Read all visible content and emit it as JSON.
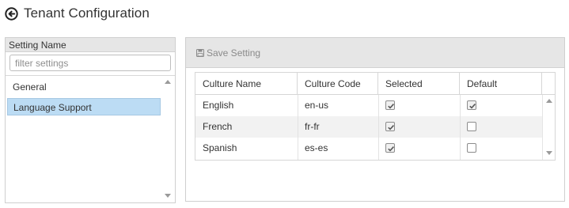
{
  "header": {
    "title": "Tenant Configuration",
    "back_icon": "circle-arrow-left-icon"
  },
  "settings_panel": {
    "header": "Setting Name",
    "filter": {
      "placeholder": "filter settings",
      "value": ""
    },
    "items": [
      {
        "label": "General",
        "selected": false
      },
      {
        "label": "Language Support",
        "selected": true
      }
    ]
  },
  "detail_panel": {
    "toolbar": {
      "save_label": "Save Setting",
      "save_icon": "floppy-disk-icon"
    },
    "grid": {
      "columns": [
        "Culture Name",
        "Culture Code",
        "Selected",
        "Default"
      ],
      "rows": [
        {
          "culture_name": "English",
          "culture_code": "en-us",
          "selected": true,
          "default": true
        },
        {
          "culture_name": "French",
          "culture_code": "fr-fr",
          "selected": true,
          "default": false
        },
        {
          "culture_name": "Spanish",
          "culture_code": "es-es",
          "selected": true,
          "default": false
        }
      ]
    }
  },
  "colors": {
    "selected_row": "#bcdcf4",
    "panel_header": "#e6e6e6",
    "disabled_text": "#8a8a8a"
  }
}
